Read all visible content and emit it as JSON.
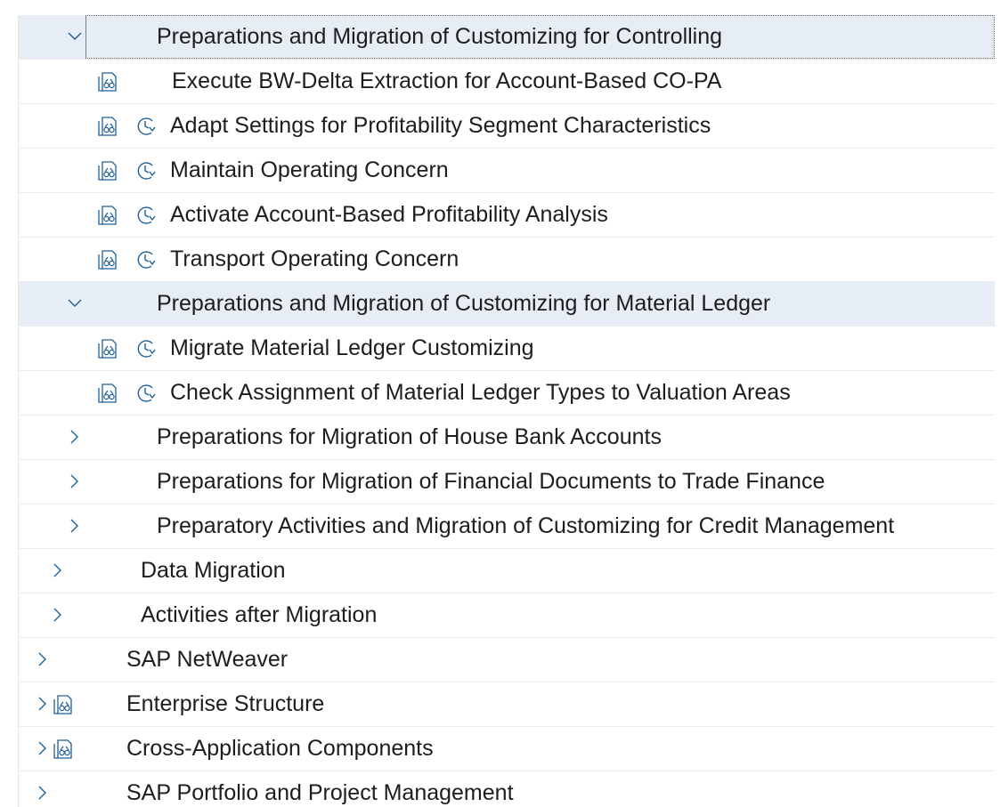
{
  "tree": {
    "rows": [
      {
        "label": "Preparations and Migration of Customizing for Controlling",
        "expanded": true,
        "selected": true,
        "focused": true,
        "icons": []
      },
      {
        "label": "Execute BW-Delta Extraction for Account-Based CO-PA",
        "icons": [
          "documentation-icon"
        ]
      },
      {
        "label": "Adapt Settings for Profitability Segment Characteristics",
        "icons": [
          "documentation-icon",
          "execute-activity-icon"
        ]
      },
      {
        "label": "Maintain Operating Concern",
        "icons": [
          "documentation-icon",
          "execute-activity-icon"
        ]
      },
      {
        "label": "Activate Account-Based Profitability Analysis",
        "icons": [
          "documentation-icon",
          "execute-activity-icon"
        ]
      },
      {
        "label": "Transport Operating Concern",
        "icons": [
          "documentation-icon",
          "execute-activity-icon"
        ]
      },
      {
        "label": "Preparations and Migration of Customizing for Material Ledger",
        "expanded": true,
        "selected": true,
        "icons": []
      },
      {
        "label": "Migrate Material Ledger Customizing",
        "icons": [
          "documentation-icon",
          "execute-activity-icon"
        ]
      },
      {
        "label": "Check Assignment of Material Ledger Types to Valuation Areas",
        "icons": [
          "documentation-icon",
          "execute-activity-icon"
        ]
      },
      {
        "label": "Preparations for Migration of House Bank Accounts",
        "expanded": false,
        "icons": []
      },
      {
        "label": "Preparations for Migration of Financial Documents to Trade Finance",
        "expanded": false,
        "icons": []
      },
      {
        "label": "Preparatory Activities and Migration of Customizing for Credit Management",
        "expanded": false,
        "icons": []
      },
      {
        "label": "Data Migration",
        "expanded": false,
        "icons": []
      },
      {
        "label": "Activities after Migration",
        "expanded": false,
        "icons": []
      },
      {
        "label": "SAP NetWeaver",
        "expanded": false,
        "icons": []
      },
      {
        "label": "Enterprise Structure",
        "expanded": false,
        "icons": [
          "documentation-icon"
        ]
      },
      {
        "label": "Cross-Application Components",
        "expanded": false,
        "icons": [
          "documentation-icon"
        ]
      },
      {
        "label": "SAP Portfolio and Project Management",
        "expanded": false,
        "icons": []
      }
    ]
  }
}
